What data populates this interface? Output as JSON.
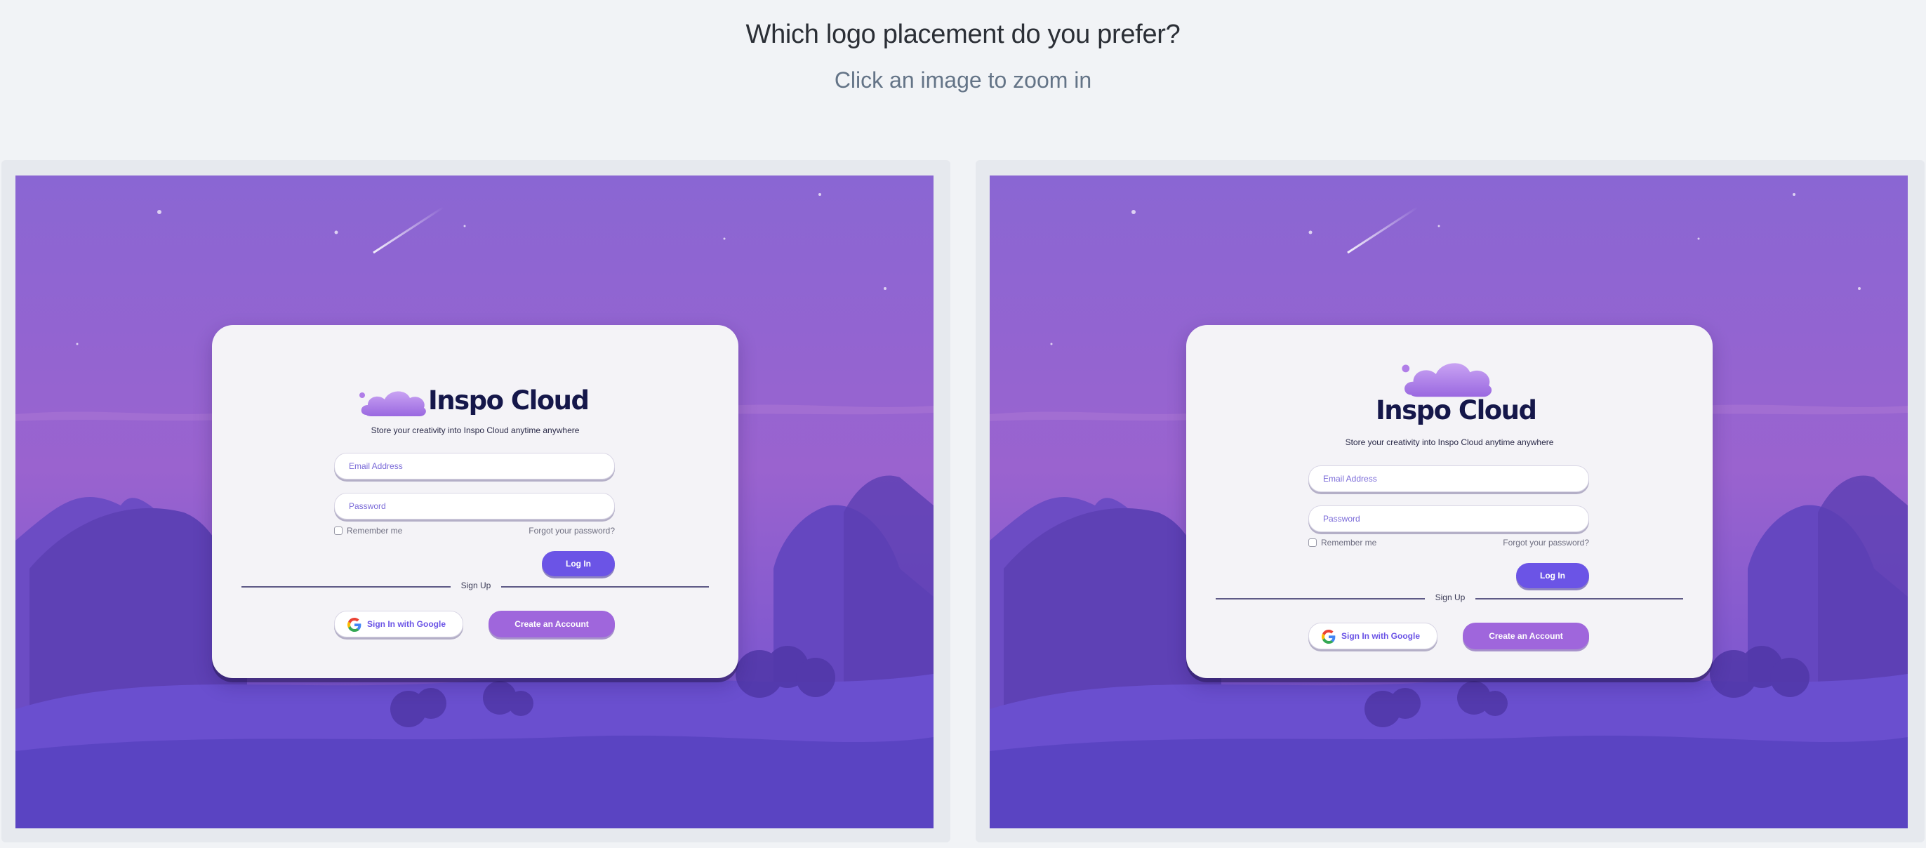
{
  "header": {
    "title": "Which logo placement do you prefer?",
    "subtitle": "Click an image to zoom in"
  },
  "options": [
    {
      "logo_layout": "inline",
      "login_card": {
        "logo_icon": "cloud-icon",
        "brand_name": "Inspo Cloud",
        "tagline": "Store your creativity into Inspo Cloud anytime anywhere",
        "email_placeholder": "Email Address",
        "password_placeholder": "Password",
        "remember_label": "Remember me",
        "forgot_label": "Forgot your password?",
        "login_label": "Log In",
        "divider_label": "Sign Up",
        "google_label": "Sign In with Google",
        "create_label": "Create an Account"
      }
    },
    {
      "logo_layout": "stacked",
      "login_card": {
        "logo_icon": "cloud-icon",
        "brand_name": "Inspo Cloud",
        "tagline": "Store your creativity into Inspo Cloud anytime anywhere",
        "email_placeholder": "Email Address",
        "password_placeholder": "Password",
        "remember_label": "Remember me",
        "forgot_label": "Forgot your password?",
        "login_label": "Log In",
        "divider_label": "Sign Up",
        "google_label": "Sign In with Google",
        "create_label": "Create an Account"
      }
    }
  ],
  "colors": {
    "page_background": "#f1f3f6",
    "sky_top": "#8a66d3",
    "sky_mid": "#9a63cf",
    "sky_bottom": "#6f4fcc",
    "primary_button": "#6b54e6",
    "secondary_button": "#9f66dc",
    "brand_text": "#15174a",
    "card_background": "#f4f3f7"
  }
}
